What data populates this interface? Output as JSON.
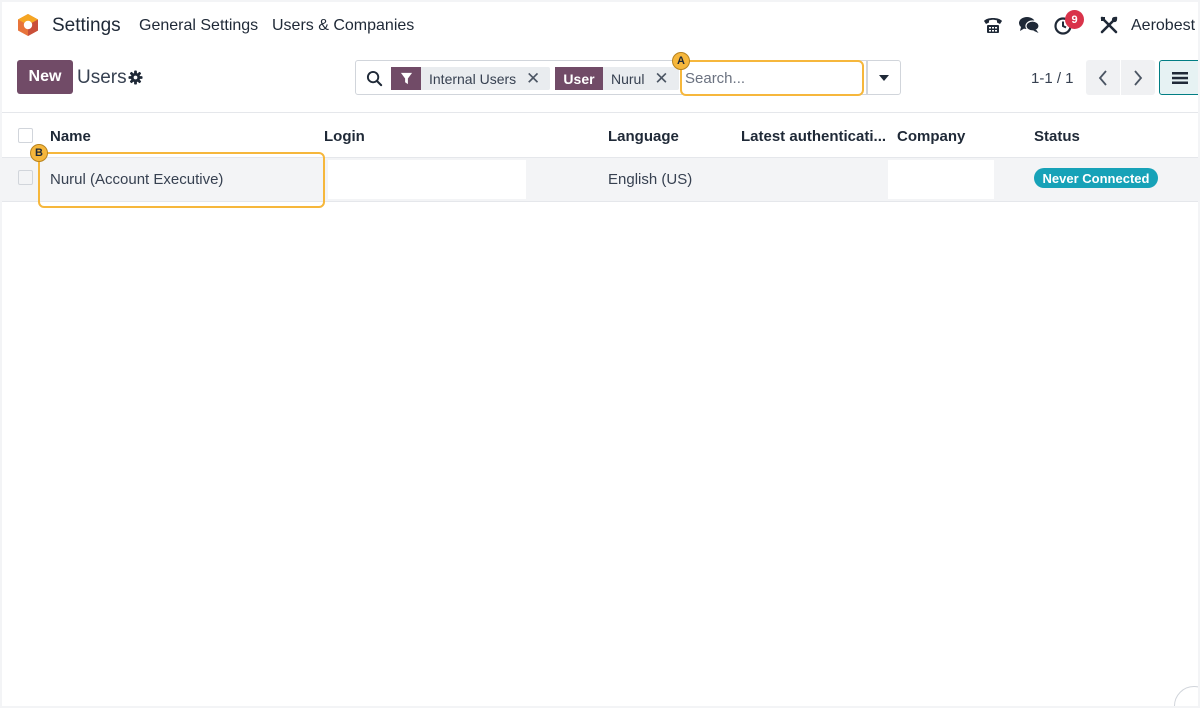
{
  "navbar": {
    "app_name": "Settings",
    "menus": [
      "General Settings",
      "Users & Companies"
    ],
    "icons": [
      "phone-icon",
      "chat-icon",
      "activity-clock-icon",
      "debug-tools-icon"
    ],
    "activity_count": "9",
    "company": "Aerobest"
  },
  "control_panel": {
    "new_label": "New",
    "title": "Users",
    "search": {
      "facets": [
        {
          "icon": "filter-icon",
          "value": "Internal Users"
        },
        {
          "tag": "User",
          "value": "Nurul"
        }
      ],
      "placeholder": "Search..."
    },
    "pager": "1-1 / 1"
  },
  "list": {
    "columns": [
      "Name",
      "Login",
      "Language",
      "Latest authenticati...",
      "Company",
      "Status"
    ],
    "rows": [
      {
        "name": "Nurul (Account Executive)",
        "login": "",
        "language": "English (US)",
        "latest_auth": "",
        "company": "",
        "status": "Never Connected"
      }
    ]
  },
  "annotations": [
    "A",
    "B"
  ],
  "colors": {
    "primary": "#714b67",
    "status_badge": "#17a2b8",
    "highlight": "#f6b73c",
    "notification": "#d9334a"
  }
}
